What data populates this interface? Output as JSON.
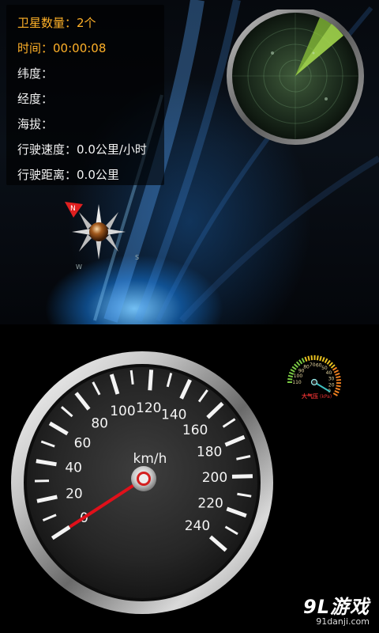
{
  "info": {
    "satellites_label": "卫星数量：",
    "satellites_value": "2个",
    "time_label": "时间：",
    "time_value": "00:00:08",
    "latitude_label": "纬度：",
    "latitude_value": "",
    "longitude_label": "经度：",
    "longitude_value": "",
    "altitude_label": "海拔：",
    "altitude_value": "",
    "speed_label": "行驶速度：",
    "speed_value": "0.0公里/小时",
    "distance_label": "行驶距离：",
    "distance_value": "0.0公里"
  },
  "speedometer": {
    "unit": "km/h",
    "ticks": [
      "0",
      "20",
      "40",
      "60",
      "80",
      "100",
      "120",
      "140",
      "160",
      "180",
      "200",
      "220",
      "240"
    ],
    "min": 0,
    "max": 240,
    "speed": 0
  },
  "barometer": {
    "label": "大气压",
    "unit": "(kPa)",
    "ticks": [
      "110",
      "100",
      "90",
      "80",
      "70",
      "60",
      "50",
      "40",
      "30",
      "20",
      "0"
    ]
  },
  "watermark": {
    "brand": "9L游戏",
    "site": "91danji.com"
  },
  "colors": {
    "accent": "#ffb128",
    "needle": "#e0101a",
    "radar_sweep": "#8bc33a"
  }
}
